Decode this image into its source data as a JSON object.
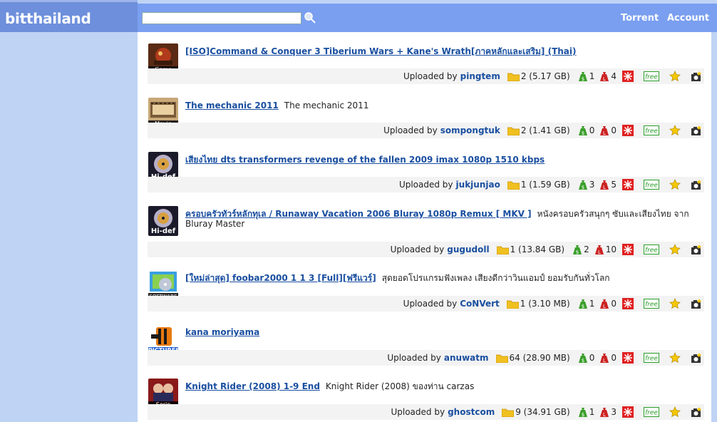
{
  "site": {
    "logo": "bitthailand"
  },
  "search": {
    "placeholder": "",
    "value": ""
  },
  "nav": {
    "torrent": "Torrent",
    "account": "Account"
  },
  "uploaded_by_label": "Uploaded by",
  "entries": [
    {
      "category": "Game",
      "title": "[ISO]Command & Conquer 3 Tiberium Wars + Kane's Wrath[ภาคหลักและเสริม] (Thai)",
      "description": "",
      "uploader": "pingtem",
      "files": "2 (5.17 GB)",
      "seeders": "1",
      "leechers": "4"
    },
    {
      "category": "Movie",
      "title": "The mechanic 2011",
      "description": "The mechanic 2011",
      "uploader": "sompongtuk",
      "files": "2 (1.41 GB)",
      "seeders": "0",
      "leechers": "0"
    },
    {
      "category": "Hi-def",
      "title": "เสียงไทย dts transformers revenge of the fallen 2009 imax 1080p 1510 kbps",
      "description": "",
      "uploader": "jukjunjao",
      "files": "1 (1.59 GB)",
      "seeders": "3",
      "leechers": "5"
    },
    {
      "category": "Hi-def",
      "title": "ครอบครัวทัวร์หลักทุเล / Runaway Vacation 2006 Bluray 1080p Remux [ MKV ]",
      "description": "หนังครอบครัวสนุกๆ ซับและเสียงไทย จาก Bluray Master",
      "uploader": "gugudoll",
      "files": "1 (13.84 GB)",
      "seeders": "2",
      "leechers": "10"
    },
    {
      "category": "SOFTWARE",
      "title": "[ใหม่ล่าสุด] foobar2000 1 1 3 [Full][ฟรีแวร์]",
      "description": "สุดยอดโปรแกรมฟังเพลง เสียงดีกว่าวินแอมป์ ยอมรับกันทั่วโลก",
      "uploader": "CoNVert",
      "files": "1 (3.10 MB)",
      "seeders": "1",
      "leechers": "0"
    },
    {
      "category": "PICTURES",
      "title": "kana moriyama",
      "description": "",
      "uploader": "anuwatm",
      "files": "64 (28.90 MB)",
      "seeders": "0",
      "leechers": "0"
    },
    {
      "category": "Serie",
      "title": "Knight Rider (2008) 1-9 End",
      "description": "Knight Rider (2008) ของท่าน carzas",
      "uploader": "ghostcom",
      "files": "9 (34.91 GB)",
      "seeders": "1",
      "leechers": "3"
    }
  ],
  "icons": {
    "free_label": "free"
  },
  "colors": {
    "header": "#6d8fdc",
    "topbar": "#7a9ff0",
    "sidebar": "#bfd3f5",
    "link": "#1a4fa0",
    "seed": "#3a9e2a",
    "leech": "#cc2222"
  }
}
